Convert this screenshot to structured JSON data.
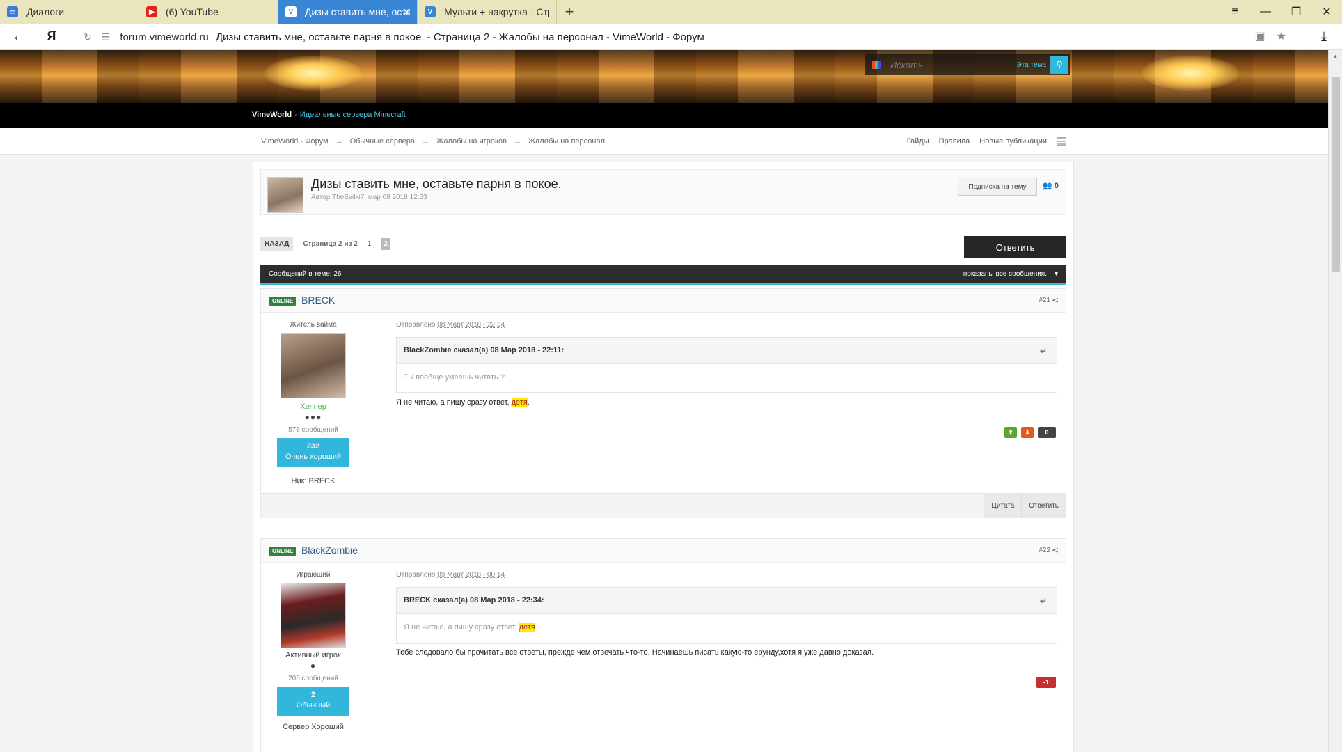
{
  "browser": {
    "tabs": [
      {
        "label": "Диалоги",
        "icon": "chat-icon",
        "color": "#3a7bd5"
      },
      {
        "label": "(6) YouTube",
        "icon": "youtube-icon",
        "color": "#e62117"
      },
      {
        "label": "Дизы ставить мне, оставьте парня в покое.",
        "icon": "vimeworld-icon",
        "color": "#ffffff",
        "active": true
      },
      {
        "label": "Мульти + накрутка - Стран",
        "icon": "vimeworld-icon",
        "color": "#3a86d6"
      }
    ],
    "new_tab": "+",
    "window_controls": {
      "menu": "≡",
      "minimize": "—",
      "restore": "❐",
      "close": "✕"
    },
    "url_domain": "forum.vimeworld.ru",
    "url_title": "Дизы ставить мне, оставьте парня в покое. - Страница 2 - Жалобы на персонал - VimeWorld - Форум",
    "ya_logo": "Я"
  },
  "header": {
    "search_placeholder": "Искать...",
    "search_scope": "Эта тема",
    "brand_name": "VimeWorld",
    "brand_separator": "-",
    "brand_tagline": "Идеальные сервера Minecraft"
  },
  "breadcrumbs": [
    "VimeWorld - Форум",
    "Обычные сервера",
    "Жалобы на игроков",
    "Жалобы на персонал"
  ],
  "breadcrumb_sep": "→",
  "quicklinks": [
    "Гайды",
    "Правила",
    "Новые публикации"
  ],
  "topic": {
    "title": "Дизы ставить мне, оставьте парня в покое.",
    "meta": "Автор TheEvilki7, мар 08 2018 12:53",
    "subscribe_label": "Подписка на тему",
    "followers": "0"
  },
  "pager": {
    "back": "НАЗАД",
    "info": "Страница 2 из 2",
    "page1": "1",
    "page2": "2",
    "reply": "Ответить"
  },
  "posts_bar": {
    "count": "Сообщений в теме: 26",
    "filter": "показаны все сообщения.",
    "caret": "▾"
  },
  "posts": [
    {
      "status": "ONLINE",
      "author": "BRECK",
      "num": "#21",
      "rank": "Житель вайма",
      "group": "Хелпер",
      "pips": "●●●",
      "messages": "578 сообщений",
      "rep_num": "232",
      "rep_label": "Очень хороший",
      "nick": "Ник: BRECK",
      "sent_label": "Отправлено",
      "sent_date": "08 Март 2018 - 22:34",
      "quote_head": "BlackZombie сказал(а) 08 Мар 2018 - 22:11:",
      "quote_text": "Ты вообще умеешь читать ?",
      "text_before": "Я не читаю, а пишу сразу ответ, ",
      "text_hl": "детя",
      "text_after": ".",
      "vote_score": "0",
      "quote_btn": "Цитата",
      "reply_btn": "Ответить"
    },
    {
      "status": "ONLINE",
      "author": "BlackZombie",
      "num": "#22",
      "rank": "Играющий",
      "group": "Активный игрок",
      "pips": "●",
      "messages": "205 сообщений",
      "rep_num": "2",
      "rep_label": "Обычный",
      "nick": "Сервер Хороший",
      "sent_label": "Отправлено",
      "sent_date": "09 Март 2018 - 00:14",
      "quote_head": "BRECK сказал(а) 08 Мар 2018 - 22:34:",
      "quote_text_before": "Я не читаю, а пишу сразу ответ, ",
      "quote_text_hl": "детя",
      "quote_text_after": ".",
      "text": "Тебе следовало бы прочитать все ответы, прежде чем отвечать что-то. Начинаешь писать какую-то ерунду,хотя я уже давно доказал.",
      "vote_score": "-1"
    }
  ],
  "colors": {
    "accent": "#33b6dc",
    "online": "#35803c",
    "author_link": "#2f5b88",
    "group_helper": "#4aa84a",
    "highlight": "#ffea00"
  }
}
